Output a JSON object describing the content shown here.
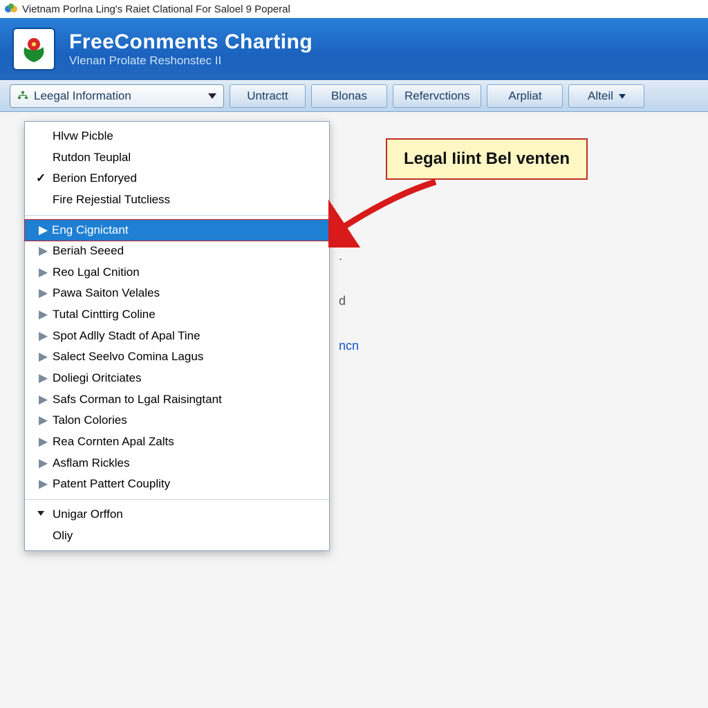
{
  "window": {
    "title": "Vietnam Porlna Ling's Raiet Clational For Saloel 9 Poperal"
  },
  "header": {
    "app_title": "FreeConments Charting",
    "app_subtitle": "Vlenan Prolate Reshonstec II"
  },
  "toolbar": {
    "dropdown_label": "Leegal Information",
    "tabs": [
      {
        "label": "Untractt"
      },
      {
        "label": "Blonas"
      },
      {
        "label": "Refervctions"
      },
      {
        "label": "Arpliat"
      },
      {
        "label": "Alteil",
        "has_caret": true
      }
    ]
  },
  "menu": {
    "group1": [
      {
        "label": "Hlvw Picble"
      },
      {
        "label": "Rutdon Teuplal"
      },
      {
        "label": "Berion Enforyed",
        "checked": true
      },
      {
        "label": "Fire Rejestial Tutcliess"
      }
    ],
    "group2": [
      {
        "label": "Eng Cignictant",
        "selected": true
      },
      {
        "label": "Beriah Seeed"
      },
      {
        "label": "Reo Lgal Cnition"
      },
      {
        "label": "Pawa Saiton Velales"
      },
      {
        "label": "Tutal Cinttirg Coline"
      },
      {
        "label": "Spot Adlly Stadt of Apal Tine"
      },
      {
        "label": "Salect Seelvo Comina Lagus"
      },
      {
        "label": "Doliegi Oritciates"
      },
      {
        "label": "Safs Corman to Lgal Raisingtant"
      },
      {
        "label": "Talon Colories"
      },
      {
        "label": "Rea Cornten Apal Zalts"
      },
      {
        "label": "Asflam Rickles"
      },
      {
        "label": "Patent Pattert Couplity"
      }
    ],
    "group3": [
      {
        "label": "Unigar Orffon",
        "caret": true
      },
      {
        "label": "Oliy"
      }
    ]
  },
  "callout": {
    "text": "Legal Iiint Bel venten"
  },
  "background": {
    "line1_suffix": ".",
    "line2_suffix": "d",
    "link_suffix": "ncn"
  }
}
